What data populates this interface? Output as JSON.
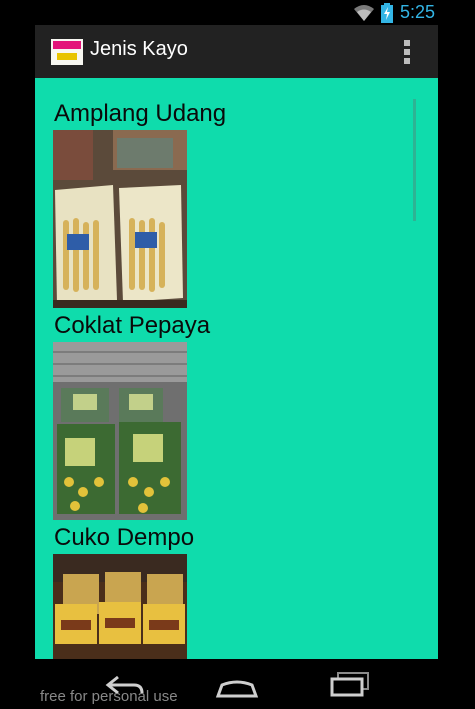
{
  "status_bar": {
    "time": "5:25"
  },
  "action_bar": {
    "title": "Jenis Kayo"
  },
  "list": {
    "items": [
      {
        "title": "Amplang Udang",
        "image": "amplang-udang-photo"
      },
      {
        "title": "Coklat Pepaya",
        "image": "coklat-pepaya-photo"
      },
      {
        "title": "Cuko Dempo",
        "image": "cuko-dempo-photo"
      }
    ]
  },
  "navigation": {
    "buttons": [
      "back-icon",
      "home-icon",
      "recent-apps-icon"
    ]
  },
  "watermark": "free for personal use",
  "colors": {
    "background": "#0fdcac",
    "action_bar": "#222222",
    "clock": "#33b5e5"
  }
}
